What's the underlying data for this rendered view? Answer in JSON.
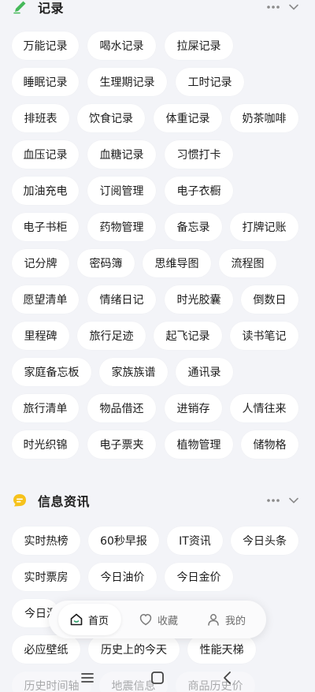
{
  "sections": {
    "records": {
      "title": "记录"
    },
    "info": {
      "title": "信息资讯"
    }
  },
  "records": [
    [
      "万能记录",
      "喝水记录",
      "拉屎记录"
    ],
    [
      "睡眠记录",
      "生理期记录",
      "工时记录"
    ],
    [
      "排班表",
      "饮食记录",
      "体重记录",
      "奶茶咖啡"
    ],
    [
      "血压记录",
      "血糖记录",
      "习惯打卡"
    ],
    [
      "加油充电",
      "订阅管理",
      "电子衣橱"
    ],
    [
      "电子书柜",
      "药物管理",
      "备忘录",
      "打牌记账"
    ],
    [
      "记分牌",
      "密码簿",
      "思维导图",
      "流程图"
    ],
    [
      "愿望清单",
      "情绪日记",
      "时光胶囊",
      "倒数日"
    ],
    [
      "里程碑",
      "旅行足迹",
      "起飞记录",
      "读书笔记"
    ],
    [
      "家庭备忘板",
      "家族族谱",
      "通讯录"
    ],
    [
      "旅行清单",
      "物品借还",
      "进销存",
      "人情往来"
    ],
    [
      "时光织锦",
      "电子票夹",
      "植物管理",
      "储物格"
    ]
  ],
  "info": [
    [
      "实时热榜",
      "60秒早报",
      "IT资讯",
      "今日头条"
    ],
    [
      "实时票房",
      "今日油价",
      "今日金价"
    ],
    [
      "今日汇"
    ],
    [
      "必应壁纸",
      "历史上的今天",
      "性能天梯"
    ],
    [
      "历史时间轴",
      "地震信息",
      "商品历史价"
    ]
  ],
  "nav": {
    "home": "首页",
    "favorites": "收藏",
    "me": "我的"
  },
  "colors": {
    "background": "#f3f4f8",
    "chip": "#ffffff",
    "records_icon": "#46b95a",
    "info_icon": "#f6c21c"
  },
  "icons": {
    "records": "pen-icon",
    "info": "message-icon",
    "more": "more-icon",
    "collapse": "chevron-down-icon",
    "home": "home-icon",
    "favorites": "bookmark-icon",
    "me": "user-icon"
  }
}
